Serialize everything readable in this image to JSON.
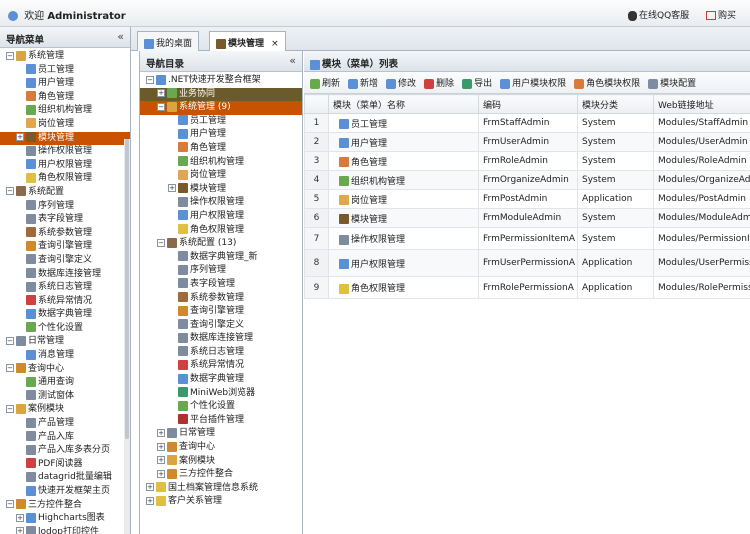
{
  "topbar": {
    "welcome": "欢迎",
    "user": "Administrator",
    "qq": "在线QQ客服",
    "buy": "购买"
  },
  "nav": {
    "title": "导航菜单",
    "items": [
      {
        "t": "系统管理",
        "d": 0,
        "ex": "-",
        "c": "#d9a441"
      },
      {
        "t": "员工管理",
        "d": 1,
        "c": "#5b8fd6"
      },
      {
        "t": "用户管理",
        "d": 1,
        "c": "#5b8fd6"
      },
      {
        "t": "角色管理",
        "d": 1,
        "c": "#d67b3b"
      },
      {
        "t": "组织机构管理",
        "d": 1,
        "c": "#6aa84f"
      },
      {
        "t": "岗位管理",
        "d": 1,
        "c": "#e0a84a"
      },
      {
        "t": "模块管理",
        "d": 1,
        "c": "#7a5a2a",
        "sel": true,
        "ex": "+"
      },
      {
        "t": "操作权限管理",
        "d": 1,
        "c": "#7f8ca0"
      },
      {
        "t": "用户权限管理",
        "d": 1,
        "c": "#5b8fd6"
      },
      {
        "t": "角色权限管理",
        "d": 1,
        "c": "#e0c040"
      },
      {
        "t": "系统配置",
        "d": 0,
        "ex": "-",
        "c": "#8a6a4a"
      },
      {
        "t": "序列管理",
        "d": 1,
        "c": "#7f8ca0"
      },
      {
        "t": "表字段管理",
        "d": 1,
        "c": "#7f8ca0"
      },
      {
        "t": "系统参数管理",
        "d": 1,
        "c": "#a06a3a"
      },
      {
        "t": "查询引擎管理",
        "d": 1,
        "c": "#d08a2a"
      },
      {
        "t": "查询引擎定义",
        "d": 1,
        "c": "#7f8ca0"
      },
      {
        "t": "数据库连接管理",
        "d": 1,
        "c": "#7f8ca0"
      },
      {
        "t": "系统日志管理",
        "d": 1,
        "c": "#7f8ca0"
      },
      {
        "t": "系统异常情况",
        "d": 1,
        "c": "#d04040"
      },
      {
        "t": "数据字典管理",
        "d": 1,
        "c": "#5b8fd6"
      },
      {
        "t": "个性化设置",
        "d": 1,
        "c": "#6aa84f"
      },
      {
        "t": "日常管理",
        "d": 0,
        "ex": "-",
        "c": "#7f8ca0"
      },
      {
        "t": "消息管理",
        "d": 1,
        "c": "#5b8fd6"
      },
      {
        "t": "查询中心",
        "d": 0,
        "ex": "-",
        "c": "#d08a2a"
      },
      {
        "t": "通用查询",
        "d": 1,
        "c": "#6aa84f"
      },
      {
        "t": "测试窗体",
        "d": 1,
        "c": "#7f8ca0"
      },
      {
        "t": "案例模块",
        "d": 0,
        "ex": "-",
        "c": "#d9a441"
      },
      {
        "t": "产品管理",
        "d": 1,
        "c": "#7f8ca0"
      },
      {
        "t": "产品入库",
        "d": 1,
        "c": "#7f8ca0"
      },
      {
        "t": "产品入库多表分页",
        "d": 1,
        "c": "#7f8ca0"
      },
      {
        "t": "PDF阅读器",
        "d": 1,
        "c": "#d04040"
      },
      {
        "t": "datagrid批量编辑",
        "d": 1,
        "c": "#7f8ca0"
      },
      {
        "t": "快速开发框架主页",
        "d": 1,
        "c": "#5b8fd6"
      },
      {
        "t": "三方控件整合",
        "d": 0,
        "ex": "-",
        "c": "#d08a2a"
      },
      {
        "t": "Highcharts图表",
        "d": 1,
        "ex": "+",
        "c": "#5b8fd6"
      },
      {
        "t": "lodop打印控件",
        "d": 1,
        "ex": "+",
        "c": "#7f8ca0"
      }
    ]
  },
  "tabs": [
    {
      "label": "我的桌面"
    },
    {
      "label": "模块管理",
      "close": "×"
    }
  ],
  "dir": {
    "title": "导航目录",
    "items": [
      {
        "t": ".NET快速开发整合框架",
        "d": 0,
        "ex": "-",
        "c": "#5b8fd6"
      },
      {
        "t": "业务协同",
        "d": 1,
        "ex": "+",
        "c": "#6aa84f",
        "hl": "dark"
      },
      {
        "t": "系统管理 (9)",
        "d": 1,
        "ex": "-",
        "c": "#d9a441",
        "hl": "sel"
      },
      {
        "t": "员工管理",
        "d": 2,
        "c": "#5b8fd6"
      },
      {
        "t": "用户管理",
        "d": 2,
        "c": "#5b8fd6"
      },
      {
        "t": "角色管理",
        "d": 2,
        "c": "#d67b3b"
      },
      {
        "t": "组织机构管理",
        "d": 2,
        "c": "#6aa84f"
      },
      {
        "t": "岗位管理",
        "d": 2,
        "c": "#e0a84a"
      },
      {
        "t": "模块管理",
        "d": 2,
        "ex": "+",
        "c": "#7a5a2a"
      },
      {
        "t": "操作权限管理",
        "d": 2,
        "c": "#7f8ca0"
      },
      {
        "t": "用户权限管理",
        "d": 2,
        "c": "#5b8fd6"
      },
      {
        "t": "角色权限管理",
        "d": 2,
        "c": "#e0c040"
      },
      {
        "t": "系统配置 (13)",
        "d": 1,
        "ex": "-",
        "c": "#8a6a4a"
      },
      {
        "t": "数据字典管理_新",
        "d": 2,
        "c": "#7f8ca0"
      },
      {
        "t": "序列管理",
        "d": 2,
        "c": "#7f8ca0"
      },
      {
        "t": "表字段管理",
        "d": 2,
        "c": "#7f8ca0"
      },
      {
        "t": "系统参数管理",
        "d": 2,
        "c": "#a06a3a"
      },
      {
        "t": "查询引擎管理",
        "d": 2,
        "c": "#d08a2a"
      },
      {
        "t": "查询引擎定义",
        "d": 2,
        "c": "#7f8ca0"
      },
      {
        "t": "数据库连接管理",
        "d": 2,
        "c": "#7f8ca0"
      },
      {
        "t": "系统日志管理",
        "d": 2,
        "c": "#7f8ca0"
      },
      {
        "t": "系统异常情况",
        "d": 2,
        "c": "#d04040"
      },
      {
        "t": "数据字典管理",
        "d": 2,
        "c": "#5b8fd6"
      },
      {
        "t": "MiniWeb浏览器",
        "d": 2,
        "c": "#3a9a6a"
      },
      {
        "t": "个性化设置",
        "d": 2,
        "c": "#6aa84f"
      },
      {
        "t": "平台插件管理",
        "d": 2,
        "c": "#b03030"
      },
      {
        "t": "日常管理",
        "d": 1,
        "ex": "+",
        "c": "#7f8ca0"
      },
      {
        "t": "查询中心",
        "d": 1,
        "ex": "+",
        "c": "#d08a2a"
      },
      {
        "t": "案例模块",
        "d": 1,
        "ex": "+",
        "c": "#d9a441"
      },
      {
        "t": "三方控件整合",
        "d": 1,
        "ex": "+",
        "c": "#d08a2a"
      },
      {
        "t": "国土档案管理信息系统",
        "d": 0,
        "ex": "+",
        "c": "#e0c040"
      },
      {
        "t": "客户关系管理",
        "d": 0,
        "ex": "+",
        "c": "#e0c040"
      }
    ]
  },
  "grid": {
    "title": "模块（菜单）列表",
    "toolbar": [
      {
        "label": "刷新",
        "c": "#6aa84f"
      },
      {
        "label": "新增",
        "c": "#5b8fd6"
      },
      {
        "label": "修改",
        "c": "#5b8fd6"
      },
      {
        "label": "删除",
        "c": "#d04040"
      },
      {
        "label": "导出",
        "c": "#3a9a6a"
      },
      {
        "label": "用户模块权限",
        "c": "#5b8fd6"
      },
      {
        "label": "角色模块权限",
        "c": "#d67b3b"
      },
      {
        "label": "模块配置",
        "c": "#7f8ca0"
      }
    ],
    "columns": [
      "模块（菜单）名称",
      "编码",
      "模块分类",
      "Web链接地址"
    ],
    "rows": [
      {
        "n": "1",
        "name": "员工管理",
        "code": "FrmStaffAdmin",
        "cat": "System",
        "url": "Modules/StaffAdmin",
        "c": "#5b8fd6"
      },
      {
        "n": "2",
        "name": "用户管理",
        "code": "FrmUserAdmin",
        "cat": "System",
        "url": "Modules/UserAdmin",
        "c": "#5b8fd6"
      },
      {
        "n": "3",
        "name": "角色管理",
        "code": "FrmRoleAdmin",
        "cat": "System",
        "url": "Modules/RoleAdmin",
        "c": "#d67b3b"
      },
      {
        "n": "4",
        "name": "组织机构管理",
        "code": "FrmOrganizeAdmin",
        "cat": "System",
        "url": "Modules/OrganizeAdmin",
        "c": "#6aa84f"
      },
      {
        "n": "5",
        "name": "岗位管理",
        "code": "FrmPostAdmin",
        "cat": "Application",
        "url": "Modules/PostAdmin",
        "c": "#e0a84a"
      },
      {
        "n": "6",
        "name": "模块管理",
        "code": "FrmModuleAdmin",
        "cat": "System",
        "url": "Modules/ModuleAdmin",
        "c": "#7a5a2a"
      },
      {
        "n": "7",
        "name": "操作权限管理",
        "code": "FrmPermissionItemA",
        "cat": "System",
        "url": "Modules/PermissionItem",
        "c": "#7f8ca0"
      },
      {
        "n": "8",
        "name": "用户权限管理",
        "code": "FrmUserPermissionA",
        "cat": "Application",
        "url": "Modules/UserPermission",
        "c": "#5b8fd6"
      },
      {
        "n": "9",
        "name": "角色权限管理",
        "code": "FrmRolePermissionA",
        "cat": "Application",
        "url": "Modules/RolePermission",
        "c": "#e0c040"
      }
    ]
  }
}
